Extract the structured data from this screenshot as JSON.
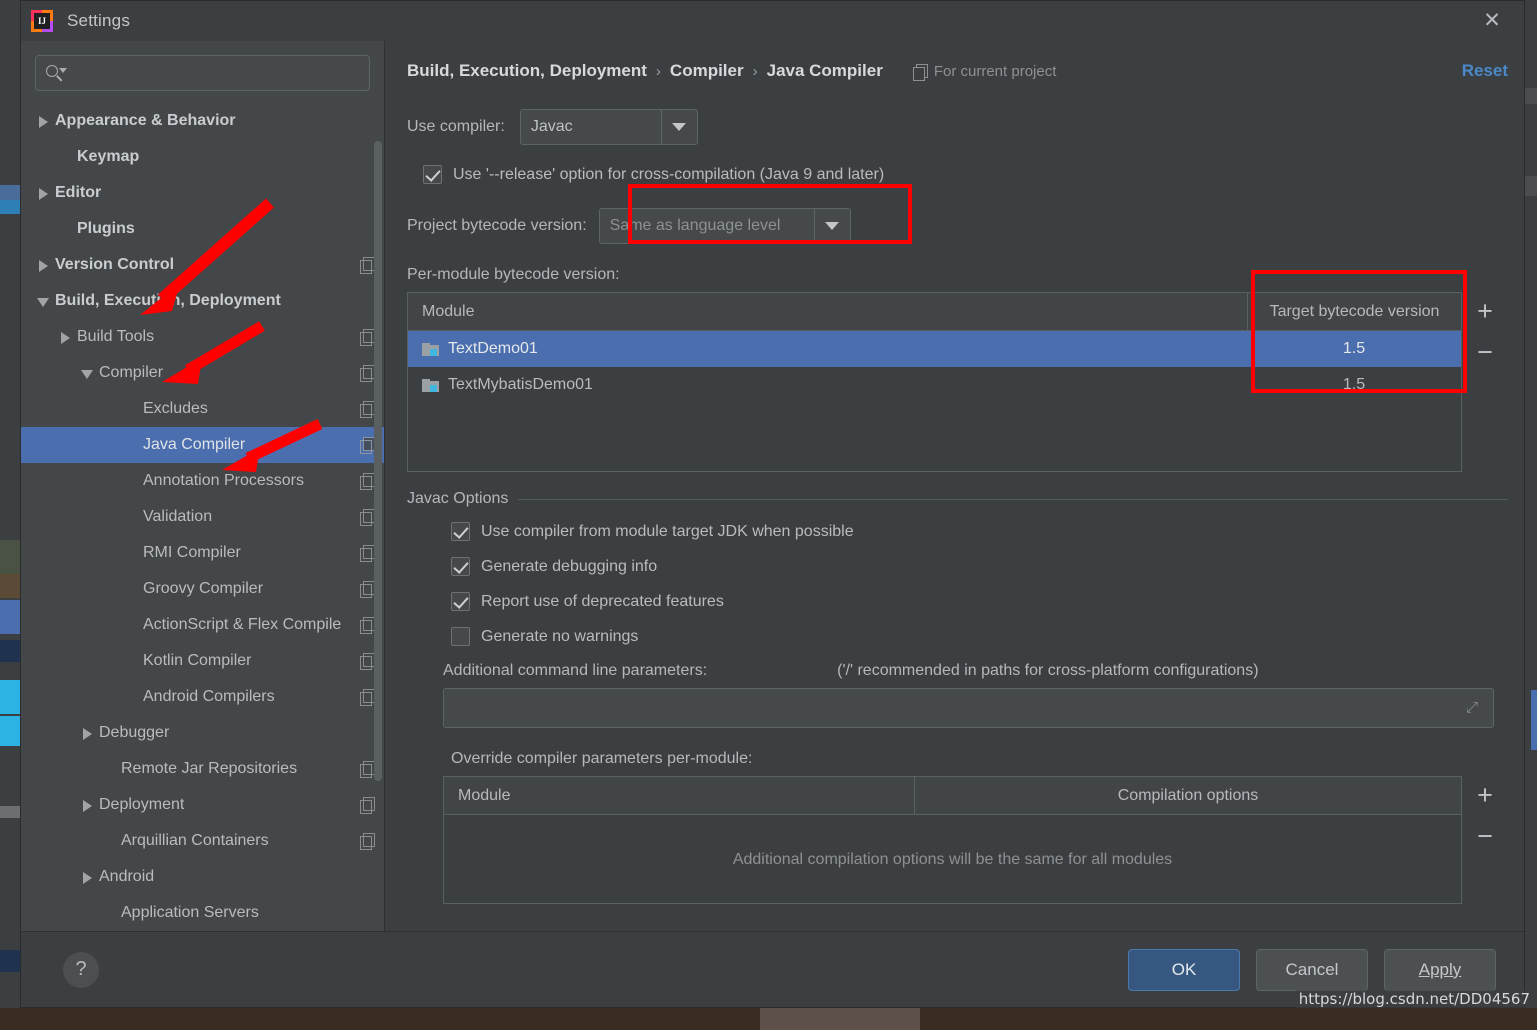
{
  "window": {
    "title": "Settings",
    "logo_text": "IJ",
    "close_icon": "✕"
  },
  "sidebar": {
    "search": {
      "value": "",
      "placeholder": ""
    },
    "items": [
      {
        "label": "Appearance & Behavior",
        "twisty": "right",
        "indent": 0,
        "bold": true,
        "copy": false,
        "selected": false
      },
      {
        "label": "Keymap",
        "twisty": "none",
        "indent": 1,
        "bold": true,
        "copy": false,
        "selected": false
      },
      {
        "label": "Editor",
        "twisty": "right",
        "indent": 0,
        "bold": true,
        "copy": false,
        "selected": false
      },
      {
        "label": "Plugins",
        "twisty": "none",
        "indent": 1,
        "bold": true,
        "copy": false,
        "selected": false
      },
      {
        "label": "Version Control",
        "twisty": "right",
        "indent": 0,
        "bold": true,
        "copy": true,
        "selected": false
      },
      {
        "label": "Build, Execution, Deployment",
        "twisty": "down",
        "indent": 0,
        "bold": true,
        "copy": false,
        "selected": false
      },
      {
        "label": "Build Tools",
        "twisty": "right",
        "indent": 1,
        "bold": false,
        "copy": true,
        "selected": false
      },
      {
        "label": "Compiler",
        "twisty": "down",
        "indent": 2,
        "bold": false,
        "copy": true,
        "selected": false
      },
      {
        "label": "Excludes",
        "twisty": "none",
        "indent": 4,
        "bold": false,
        "copy": true,
        "selected": false
      },
      {
        "label": "Java Compiler",
        "twisty": "none",
        "indent": 4,
        "bold": false,
        "copy": true,
        "selected": true
      },
      {
        "label": "Annotation Processors",
        "twisty": "none",
        "indent": 4,
        "bold": false,
        "copy": true,
        "selected": false
      },
      {
        "label": "Validation",
        "twisty": "none",
        "indent": 4,
        "bold": false,
        "copy": true,
        "selected": false
      },
      {
        "label": "RMI Compiler",
        "twisty": "none",
        "indent": 4,
        "bold": false,
        "copy": true,
        "selected": false
      },
      {
        "label": "Groovy Compiler",
        "twisty": "none",
        "indent": 4,
        "bold": false,
        "copy": true,
        "selected": false
      },
      {
        "label": "ActionScript & Flex Compile",
        "twisty": "none",
        "indent": 4,
        "bold": false,
        "copy": true,
        "selected": false
      },
      {
        "label": "Kotlin Compiler",
        "twisty": "none",
        "indent": 4,
        "bold": false,
        "copy": true,
        "selected": false
      },
      {
        "label": "Android Compilers",
        "twisty": "none",
        "indent": 4,
        "bold": false,
        "copy": true,
        "selected": false
      },
      {
        "label": "Debugger",
        "twisty": "right",
        "indent": 2,
        "bold": false,
        "copy": false,
        "selected": false
      },
      {
        "label": "Remote Jar Repositories",
        "twisty": "none",
        "indent": 3,
        "bold": false,
        "copy": true,
        "selected": false
      },
      {
        "label": "Deployment",
        "twisty": "right",
        "indent": 2,
        "bold": false,
        "copy": true,
        "selected": false
      },
      {
        "label": "Arquillian Containers",
        "twisty": "none",
        "indent": 3,
        "bold": false,
        "copy": true,
        "selected": false
      },
      {
        "label": "Android",
        "twisty": "right",
        "indent": 2,
        "bold": false,
        "copy": false,
        "selected": false
      },
      {
        "label": "Application Servers",
        "twisty": "none",
        "indent": 3,
        "bold": false,
        "copy": false,
        "selected": false
      }
    ]
  },
  "header": {
    "breadcrumbs": [
      "Build, Execution, Deployment",
      "Compiler",
      "Java Compiler"
    ],
    "separator": "›",
    "scope_label": "For current project",
    "reset_label": "Reset"
  },
  "compiler": {
    "use_compiler_label": "Use compiler:",
    "use_compiler_value": "Javac",
    "release_option_label": "Use '--release' option for cross-compilation (Java 9 and later)",
    "release_option_checked": true,
    "project_bytecode_label": "Project bytecode version:",
    "project_bytecode_value": "Same as language level",
    "per_module_label": "Per-module bytecode version:"
  },
  "module_table": {
    "columns": [
      "Module",
      "Target bytecode version"
    ],
    "rows": [
      {
        "module": "TextDemo01",
        "target": "1.5",
        "selected": true
      },
      {
        "module": "TextMybatisDemo01",
        "target": "1.5",
        "selected": false
      }
    ],
    "add_label": "+",
    "remove_label": "−"
  },
  "javac_options": {
    "group_title": "Javac Options",
    "checkboxes": [
      {
        "label": "Use compiler from module target JDK when possible",
        "checked": true
      },
      {
        "label": "Generate debugging info",
        "checked": true
      },
      {
        "label": "Report use of deprecated features",
        "checked": true
      },
      {
        "label": "Generate no warnings",
        "checked": false
      }
    ],
    "additional_params_label": "Additional command line parameters:",
    "additional_params_hint": "('/' recommended in paths for cross-platform configurations)",
    "additional_params_value": "",
    "expand_icon": "⤢",
    "override_label": "Override compiler parameters per-module:"
  },
  "override_table": {
    "columns": [
      "Module",
      "Compilation options"
    ],
    "empty_message": "Additional compilation options will be the same for all modules",
    "add_label": "+",
    "remove_label": "−"
  },
  "footer": {
    "help_label": "?",
    "ok_label": "OK",
    "cancel_label": "Cancel",
    "apply_label": "Apply"
  },
  "watermark": "https://blog.csdn.net/DD04567",
  "colors": {
    "selection_blue": "#4b6eaf",
    "primary_button": "#365880",
    "link_blue": "#4a88c7",
    "annotation_red": "#ff0000",
    "panel_bg": "#3c3f41",
    "sidebar_bg": "#434749"
  }
}
